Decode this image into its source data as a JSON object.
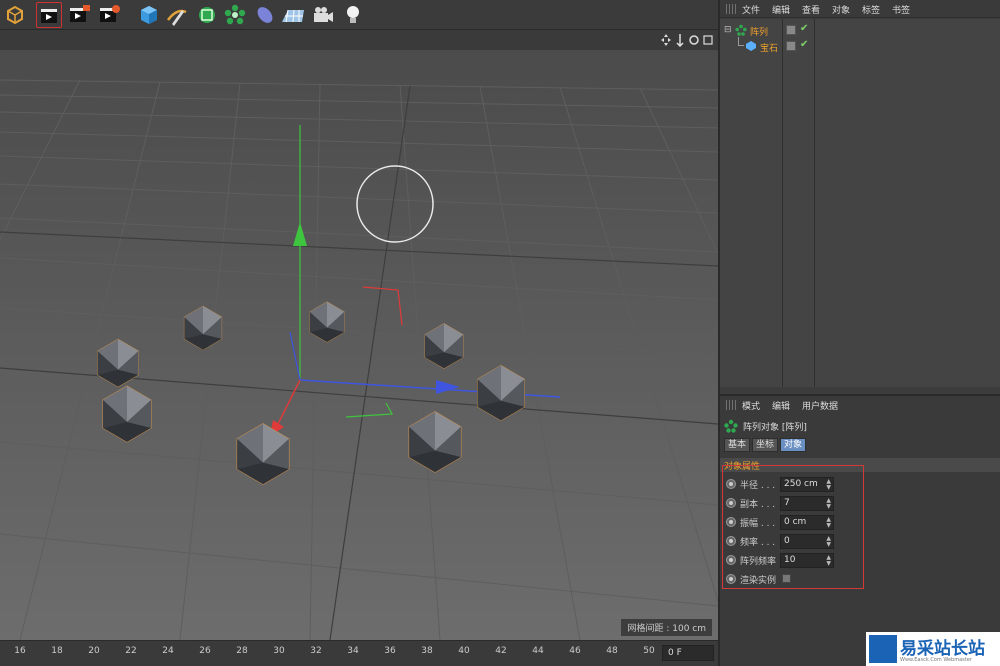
{
  "toolbar": {
    "tools": [
      "undo-cube-icon",
      "clapper-icon",
      "clapper-green-icon",
      "clapper-orange-icon",
      "cube-icon",
      "pen-icon",
      "subdivision-icon",
      "array-icon",
      "deformer-icon",
      "floor-icon",
      "camera-icon",
      "light-icon"
    ]
  },
  "viewport": {
    "grid_spacing": "网格间距 : 100 cm"
  },
  "timeline": {
    "ticks": [
      "16",
      "18",
      "20",
      "22",
      "24",
      "26",
      "28",
      "30",
      "32",
      "34",
      "36",
      "38",
      "40",
      "42",
      "44",
      "46",
      "48",
      "50"
    ],
    "current_frame": "0 F"
  },
  "object_manager": {
    "menu": [
      "文件",
      "编辑",
      "查看",
      "对象",
      "标签",
      "书签"
    ],
    "objects": [
      {
        "name": "阵列",
        "type": "array-icon"
      },
      {
        "name": "宝石",
        "type": "gem-icon"
      }
    ]
  },
  "attribute_manager": {
    "menu": [
      "模式",
      "编辑",
      "用户数据"
    ],
    "title": "阵列对象 [阵列]",
    "tabs": [
      "基本",
      "坐标",
      "对象"
    ],
    "active_tab": "对象",
    "section": "对象属性",
    "params": [
      {
        "label": "半径 . . .",
        "value": "250 cm"
      },
      {
        "label": "副本 . . .",
        "value": "7"
      },
      {
        "label": "振幅 . . .",
        "value": "0 cm"
      },
      {
        "label": "频率 . . .",
        "value": "0"
      },
      {
        "label": "阵列频率",
        "value": "10"
      },
      {
        "label": "渲染实例",
        "value": ""
      }
    ]
  },
  "watermark": {
    "text": "易采站长站",
    "sub": "Www.Easck.Com Webmaster"
  },
  "colors": {
    "accent_orange": "#f0a12c",
    "tab_active": "#6a8fc1",
    "highlight": "#d23a3a"
  }
}
